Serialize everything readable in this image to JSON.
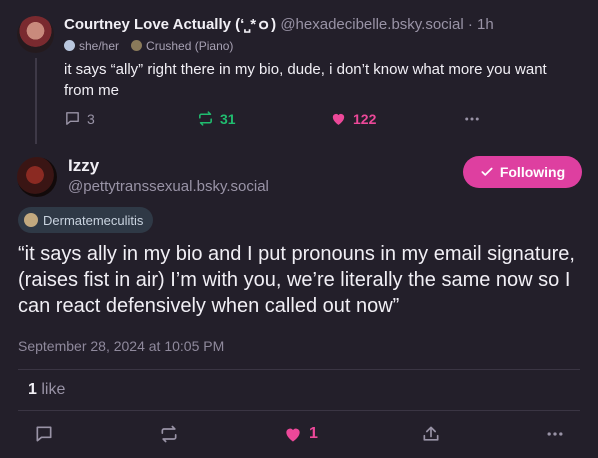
{
  "parent_post": {
    "author_name": "Courtney Love Actually (‘⎵*ｏ)",
    "handle": "@hexadecibelle.bsky.social",
    "dot": "·",
    "time": "1h",
    "pronouns": "she/her",
    "badge": "Crushed (Piano)",
    "text": "it says “ally” right there in my bio, dude, i don’t know what more you want from me",
    "reply_count": "3",
    "repost_count": "31",
    "like_count": "122"
  },
  "main_post": {
    "author_name": "Izzy",
    "handle": "@pettytranssexual.bsky.social",
    "follow_label": "Following",
    "badge": "Dermatemeculitis",
    "text": "“it says ally in my bio and I put pronouns in my email signature, (raises fist in air) I’m with you, we’re literally the same now so I can react defensively when called out now”",
    "date": "September 28, 2024 at 10:05 PM",
    "likes_count": "1",
    "likes_label": "like",
    "like_action_count": "1"
  },
  "colors": {
    "background": "#231f2a",
    "accent_pink": "#de3fa0",
    "like_pink": "#ec4899",
    "repost_green": "#20bc6f",
    "muted": "#9993a6"
  },
  "icons": [
    "reply-icon",
    "repost-icon",
    "heart-icon",
    "more-icon",
    "share-icon",
    "checkmark-icon"
  ]
}
